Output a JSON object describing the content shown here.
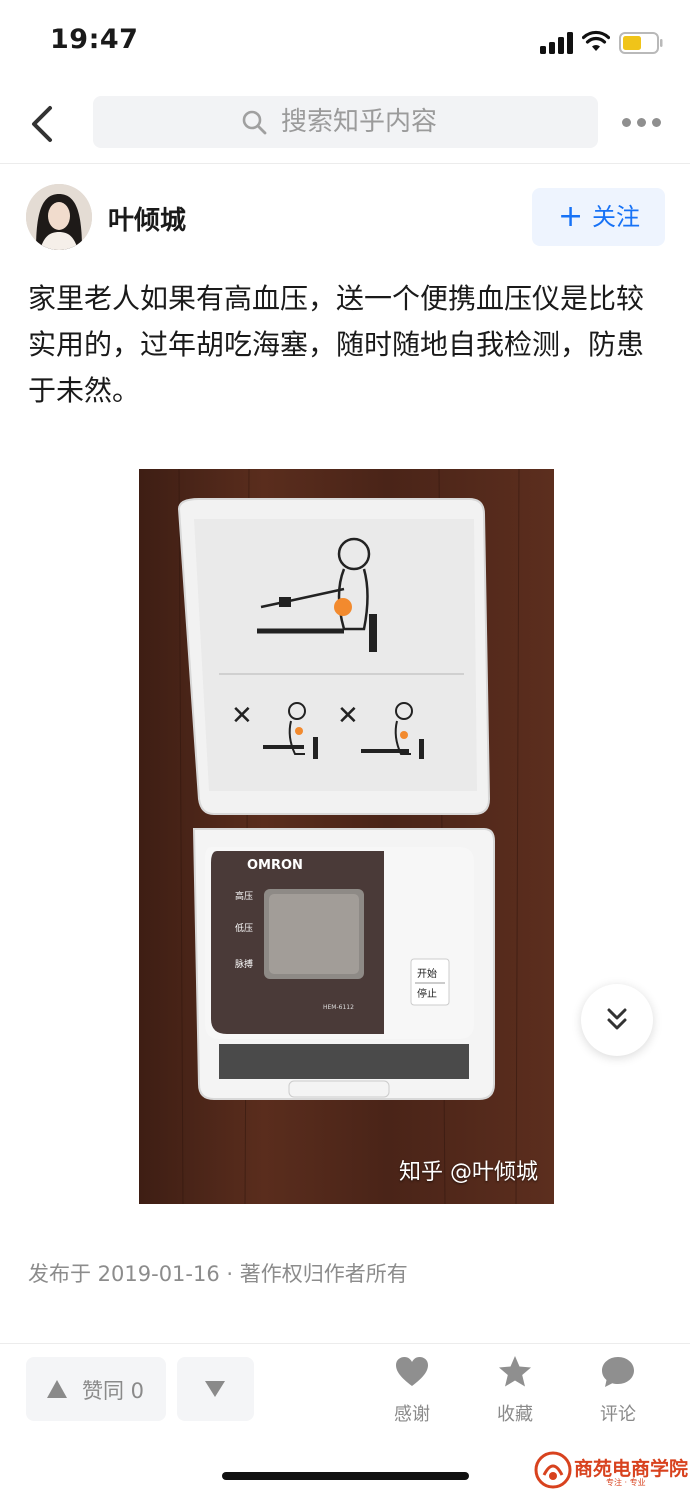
{
  "status_bar": {
    "time": "19:47",
    "icons": [
      "signal-icon",
      "wifi-icon",
      "battery-icon"
    ]
  },
  "nav": {
    "back_icon": "chevron-left-icon",
    "search_placeholder": "搜索知乎内容",
    "more_icon": "more-dots-icon"
  },
  "author": {
    "name": "叶倾城",
    "follow_label": "关注"
  },
  "answer": {
    "text": "家里老人如果有高血压，送一个便携血压仪是比较实用的，过年胡吃海塞，随时随地自我检测，防患于未然。",
    "image_watermark": "知乎 @叶倾城",
    "image_device_brand": "OMRON",
    "image_button_label_1": "开始",
    "image_button_label_2": "停止",
    "image_side_labels": [
      "高压",
      "低压",
      "脉搏"
    ],
    "image_model": "HEM-6112",
    "meta": "发布于 2019-01-16 · 著作权归作者所有"
  },
  "bottom_bar": {
    "vote_up_label": "赞同 0",
    "actions": [
      {
        "icon": "heart-icon",
        "label": "感谢"
      },
      {
        "icon": "star-icon",
        "label": "收藏"
      },
      {
        "icon": "comment-icon",
        "label": "评论"
      }
    ],
    "brand_text": "商苑电商学院",
    "brand_sub": "专注 · 专业"
  },
  "colors": {
    "accent": "#1772f6",
    "follow_bg": "#eef4fe",
    "muted_text": "#8c8c8c",
    "brand": "#d8421e"
  }
}
